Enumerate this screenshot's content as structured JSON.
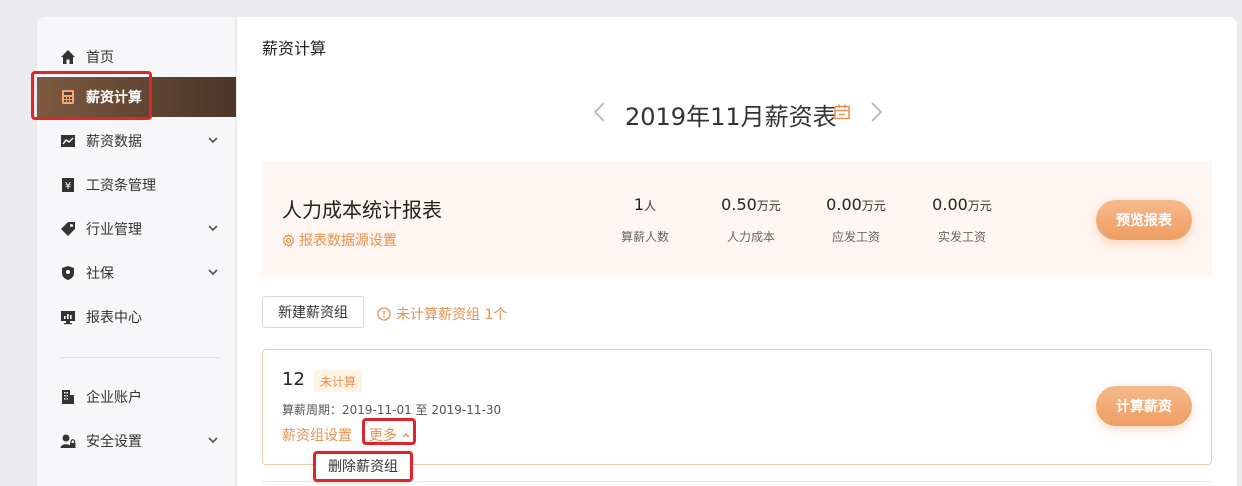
{
  "sidebar": {
    "items": [
      {
        "label": "首页",
        "icon": "home-icon"
      },
      {
        "label": "薪资计算",
        "icon": "calculator-icon",
        "active": true
      },
      {
        "label": "薪资数据",
        "icon": "chart-icon",
        "expandable": true
      },
      {
        "label": "工资条管理",
        "icon": "payslip-icon"
      },
      {
        "label": "行业管理",
        "icon": "tag-icon",
        "expandable": true
      },
      {
        "label": "社保",
        "icon": "shield-icon",
        "expandable": true
      },
      {
        "label": "报表中心",
        "icon": "monitor-icon"
      },
      {
        "label": "企业账户",
        "icon": "building-icon"
      },
      {
        "label": "安全设置",
        "icon": "user-lock-icon",
        "expandable": true
      }
    ]
  },
  "main": {
    "title": "薪资计算",
    "month_title": "2019年11月薪资表"
  },
  "cost_report": {
    "title": "人力成本统计报表",
    "datasource_link": "报表数据源设置",
    "stats": [
      {
        "value": "1",
        "unit": "人",
        "label": "算薪人数"
      },
      {
        "value": "0.50",
        "unit": "万元",
        "label": "人力成本"
      },
      {
        "value": "0.00",
        "unit": "万元",
        "label": "应发工资"
      },
      {
        "value": "0.00",
        "unit": "万元",
        "label": "实发工资"
      }
    ],
    "preview_button": "预览报表"
  },
  "groups": {
    "new_button": "新建薪资组",
    "pending_note": "未计算薪资组 1个",
    "card": {
      "name": "12",
      "status": "未计算",
      "period": "算薪周期：2019-11-01 至 2019-11-30",
      "settings_link": "薪资组设置",
      "more_link": "更多",
      "calculate_button": "计算薪资"
    },
    "dropdown": {
      "delete_item": "删除薪资组"
    }
  },
  "colors": {
    "accent": "#e5914e",
    "active_nav": "#5c4230",
    "highlight_box": "#e0242c"
  }
}
